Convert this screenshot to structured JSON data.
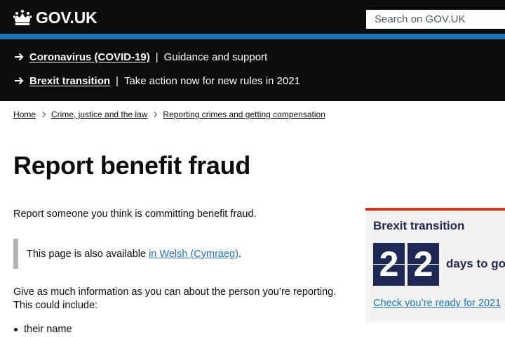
{
  "header": {
    "logo_text": "GOV.UK",
    "search_placeholder": "Search on GOV.UK",
    "colors": {
      "header_bg": "#0b0c0c",
      "accent_bar": "#1d70b8"
    }
  },
  "banner": {
    "items": [
      {
        "link": "Coronavirus (COVID-19)",
        "separator": "|",
        "description": "Guidance and support",
        "icon": "arrow-right-icon"
      },
      {
        "link": "Brexit transition",
        "separator": "|",
        "description": "Take action now for new rules in 2021",
        "icon": "arrow-right-icon"
      }
    ]
  },
  "breadcrumb": {
    "items": [
      "Home",
      "Crime, justice and the law",
      "Reporting crimes and getting compensation"
    ]
  },
  "main": {
    "title": "Report benefit fraud",
    "intro": "Report someone you think is committing benefit fraud.",
    "inset": {
      "text": "This page is also available",
      "link": "in Welsh (Cymraeg)",
      "suffix": "."
    },
    "give_info": "Give as much information as you can about the person you’re reporting. This could include:",
    "list": [
      "their name"
    ]
  },
  "promo": {
    "title": "Brexit transition",
    "digits": [
      "2",
      "2"
    ],
    "days_label": "days to go",
    "link": "Check you’re ready for 2021",
    "colors": {
      "top_border": "#d4351c",
      "navy": "#1d2a55",
      "background": "#f3f2f1"
    }
  }
}
